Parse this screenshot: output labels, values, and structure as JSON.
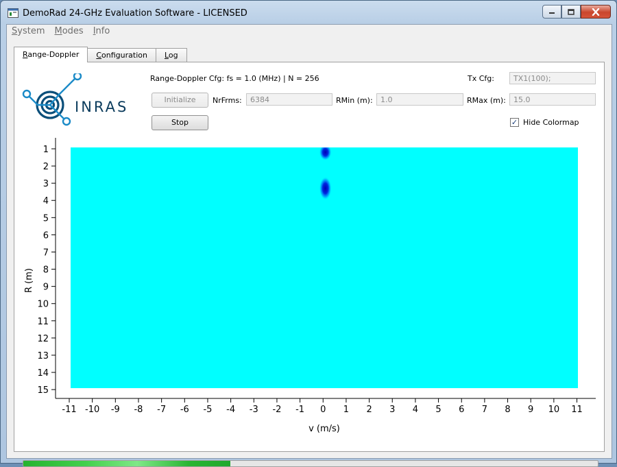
{
  "window": {
    "title": "DemoRad 24-GHz Evaluation Software - LICENSED"
  },
  "menu": [
    {
      "underlined": "S",
      "rest": "ystem"
    },
    {
      "underlined": "M",
      "rest": "odes"
    },
    {
      "underlined": "I",
      "rest": "nfo"
    }
  ],
  "tabs": [
    {
      "underlined": "R",
      "rest": "ange-Doppler"
    },
    {
      "underlined": "C",
      "rest": "onfiguration"
    },
    {
      "underlined": "L",
      "rest": "og"
    }
  ],
  "logo": {
    "text": "INRAS"
  },
  "header": {
    "cfg_text": "Range-Doppler Cfg: fs = 1.0 (MHz) | N = 256",
    "tx_label": "Tx Cfg:",
    "tx_value": "TX1(100);"
  },
  "controls": {
    "initialize_label": "Initialize",
    "stop_label": "Stop",
    "nrfrms_label": "NrFrms:",
    "nrfrms_value": "6384",
    "rmin_label": "RMin (m):",
    "rmin_value": "1.0",
    "rmax_label": "RMax (m):",
    "rmax_value": "15.0",
    "hide_colormap_label": "Hide Colormap",
    "hide_colormap_checked": true
  },
  "progress": {
    "value_fraction": 0.36
  },
  "colors": {
    "background_map": "#00ffff",
    "target": "#0000c8",
    "progress": "#2fbf37"
  },
  "chart_data": {
    "type": "heatmap",
    "xlabel": "v (m/s)",
    "ylabel": "R (m)",
    "xlim": [
      -11,
      11
    ],
    "ylim": [
      1,
      15
    ],
    "x_ticks": [
      -11,
      -10,
      -9,
      -8,
      -7,
      -6,
      -5,
      -4,
      -3,
      -2,
      -1,
      0,
      1,
      2,
      3,
      4,
      5,
      6,
      7,
      8,
      9,
      10,
      11
    ],
    "y_ticks": [
      1,
      2,
      3,
      4,
      5,
      6,
      7,
      8,
      9,
      10,
      11,
      12,
      13,
      14,
      15
    ],
    "y_inverted": true,
    "targets": [
      {
        "v": 0.1,
        "r": 1.2,
        "intensity": 1.0
      },
      {
        "v": 0.1,
        "r": 3.3,
        "intensity": 0.9
      }
    ]
  }
}
